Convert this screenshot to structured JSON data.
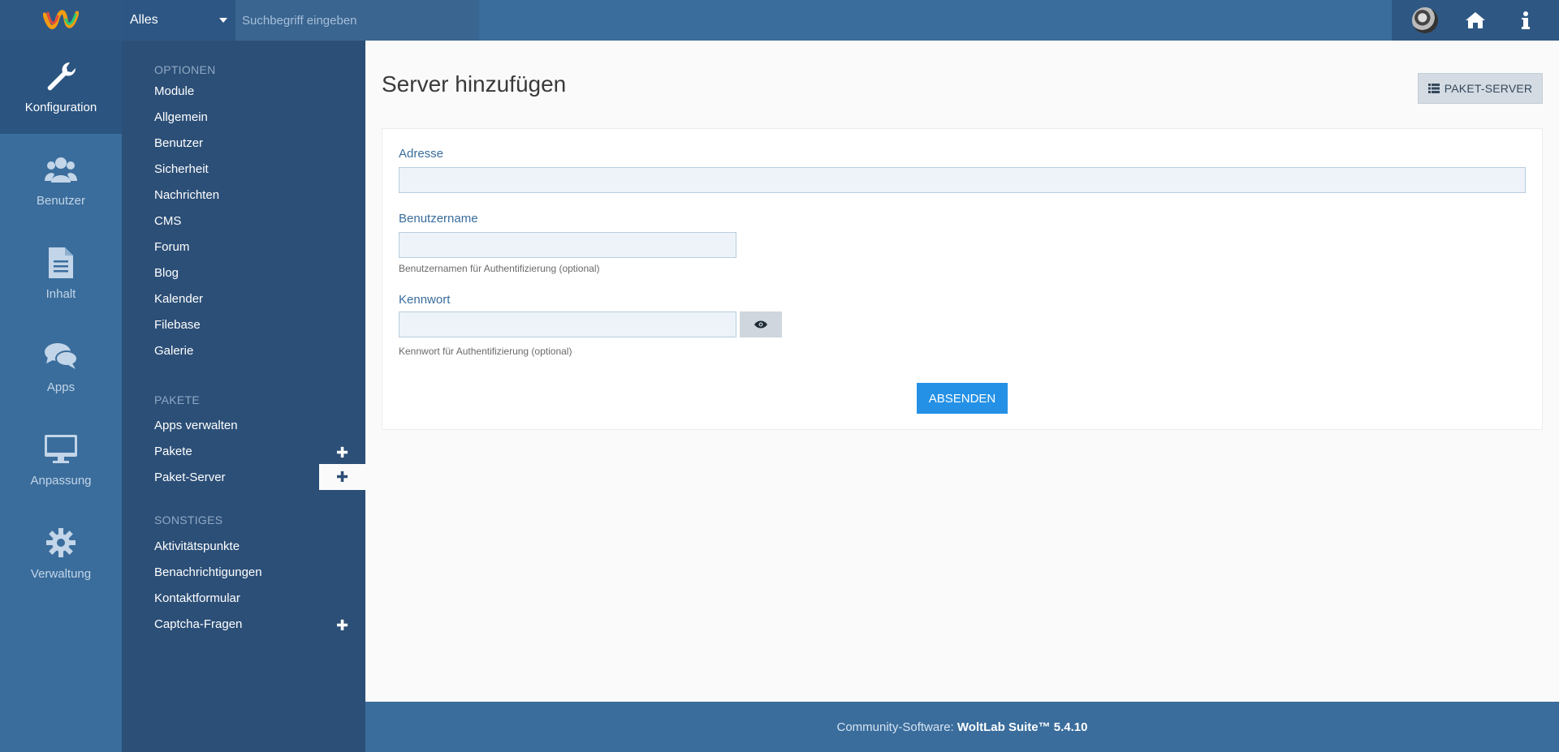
{
  "topbar": {
    "search_scope": "Alles",
    "search_placeholder": "Suchbegriff eingeben",
    "icons": [
      "avatar",
      "home-icon",
      "info-icon"
    ]
  },
  "icon_menu": [
    {
      "label": "Konfiguration",
      "icon": "wrench-icon",
      "active": true
    },
    {
      "label": "Benutzer",
      "icon": "users-icon",
      "active": false
    },
    {
      "label": "Inhalt",
      "icon": "file-icon",
      "active": false
    },
    {
      "label": "Apps",
      "icon": "comments-icon",
      "active": false
    },
    {
      "label": "Anpassung",
      "icon": "monitor-icon",
      "active": false
    },
    {
      "label": "Verwaltung",
      "icon": "gear-icon",
      "active": false
    }
  ],
  "submenu": {
    "optionen_heading": "OPTIONEN",
    "optionen": [
      "Module",
      "Allgemein",
      "Benutzer",
      "Sicherheit",
      "Nachrichten",
      "CMS",
      "Forum",
      "Blog",
      "Kalender",
      "Filebase",
      "Galerie"
    ],
    "pakete_heading": "PAKETE",
    "pakete": [
      "Apps verwalten",
      "Pakete",
      "Paket-Server"
    ],
    "sonstiges_heading": "SONSTIGES",
    "sonstiges": [
      "Aktivitätspunkte",
      "Benachrichtigungen",
      "Kontaktformular",
      "Captcha-Fragen"
    ],
    "plus_symbol": "✚"
  },
  "main": {
    "title": "Server hinzufügen",
    "paket_server_button": "PAKET-SERVER",
    "fields": {
      "address_label": "Adresse",
      "address_value": "",
      "username_label": "Benutzername",
      "username_value": "",
      "username_help": "Benutzernamen für Authentifizierung (optional)",
      "password_label": "Kennwort",
      "password_value": "",
      "password_help": "Kennwort für Authentifizierung (optional)"
    },
    "submit_label": "ABSENDEN"
  },
  "footer": {
    "prefix": "Community-Software: ",
    "product": "WoltLab Suite™ 5.4.10"
  },
  "colors": {
    "topbar": "#3a6d9c",
    "submenu": "#2c4f77",
    "accent_button": "#2591e6"
  }
}
